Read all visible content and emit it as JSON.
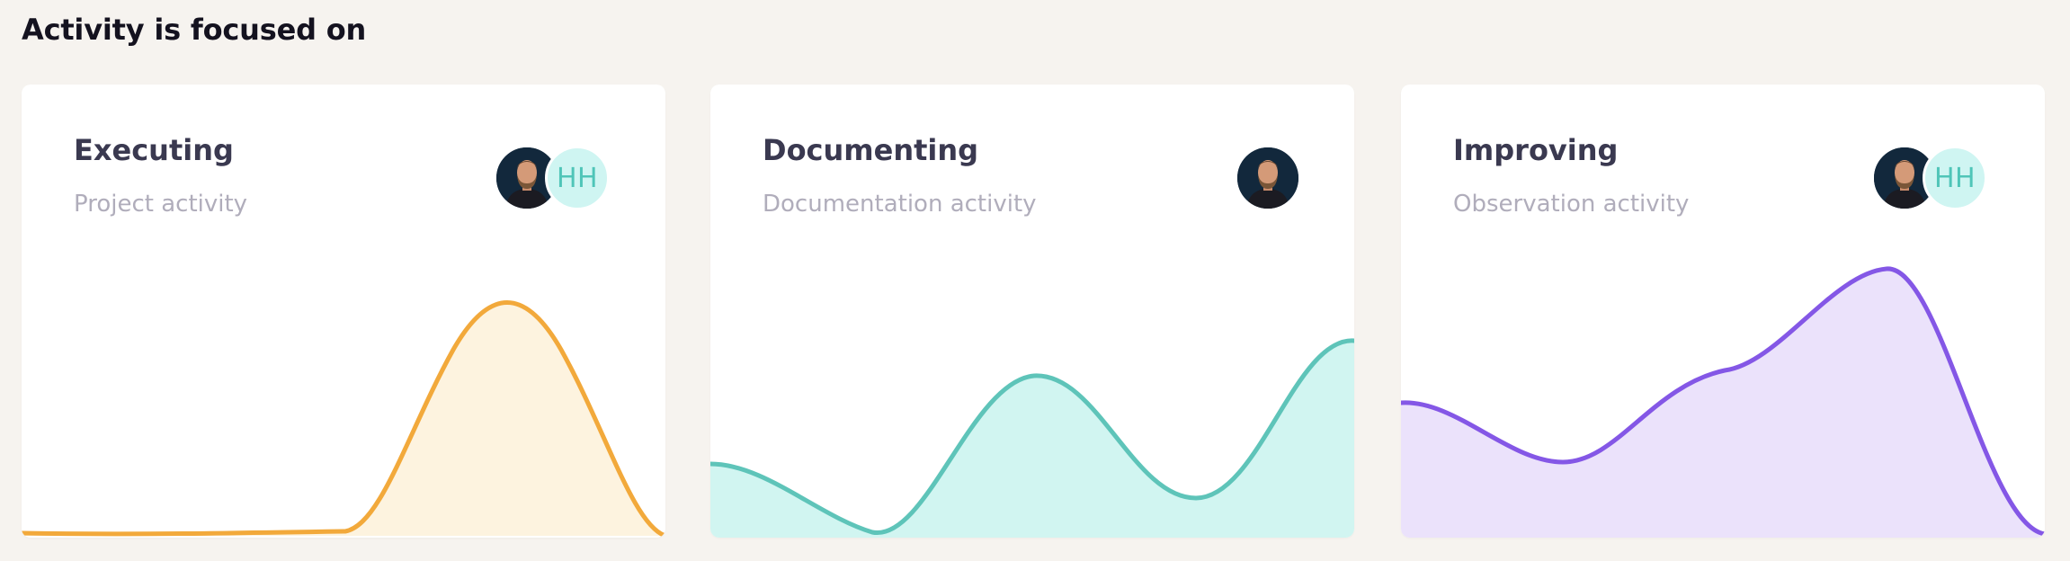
{
  "section": {
    "title": "Activity is focused on"
  },
  "cards": [
    {
      "title": "Executing",
      "subtitle": "Project activity",
      "avatars": [
        {
          "type": "photo",
          "icon": "user-photo-avatar"
        },
        {
          "type": "initials",
          "text": "HH"
        }
      ],
      "accent": "#f2a93b",
      "fill": "#fdf3df"
    },
    {
      "title": "Documenting",
      "subtitle": "Documentation activity",
      "avatars": [
        {
          "type": "photo",
          "icon": "user-photo-avatar"
        }
      ],
      "accent": "#5ec4b9",
      "fill": "#d1f5f1"
    },
    {
      "title": "Improving",
      "subtitle": "Observation activity",
      "avatars": [
        {
          "type": "photo",
          "icon": "user-photo-avatar"
        },
        {
          "type": "initials",
          "text": "HH"
        }
      ],
      "accent": "#8457e6",
      "fill": "#ebe2fb"
    }
  ]
}
